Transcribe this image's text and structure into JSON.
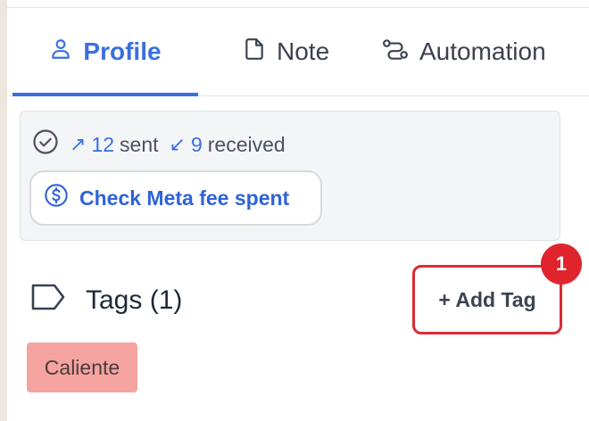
{
  "tabs": {
    "profile": "Profile",
    "note": "Note",
    "automation": "Automation"
  },
  "stats": {
    "sent_count": "12",
    "sent_label": "sent",
    "received_count": "9",
    "received_label": "received",
    "fee_button": "Check Meta fee spent"
  },
  "tags": {
    "heading": "Tags (1)",
    "add_button": "+ Add Tag",
    "badge": "1",
    "items": [
      "Caliente"
    ]
  },
  "colors": {
    "accent": "#3a6fe0",
    "highlight_border": "#dc2b35",
    "badge_bg": "#e0242e",
    "tag_bg": "#f5a3a1"
  },
  "icons": {
    "profile": "user-icon",
    "note": "document-icon",
    "automation": "route-icon",
    "stats": "check-circle-icon",
    "sent": "arrow-up-right-icon",
    "received": "arrow-down-left-icon",
    "fee": "dollar-circle-icon",
    "tags": "tag-icon"
  }
}
